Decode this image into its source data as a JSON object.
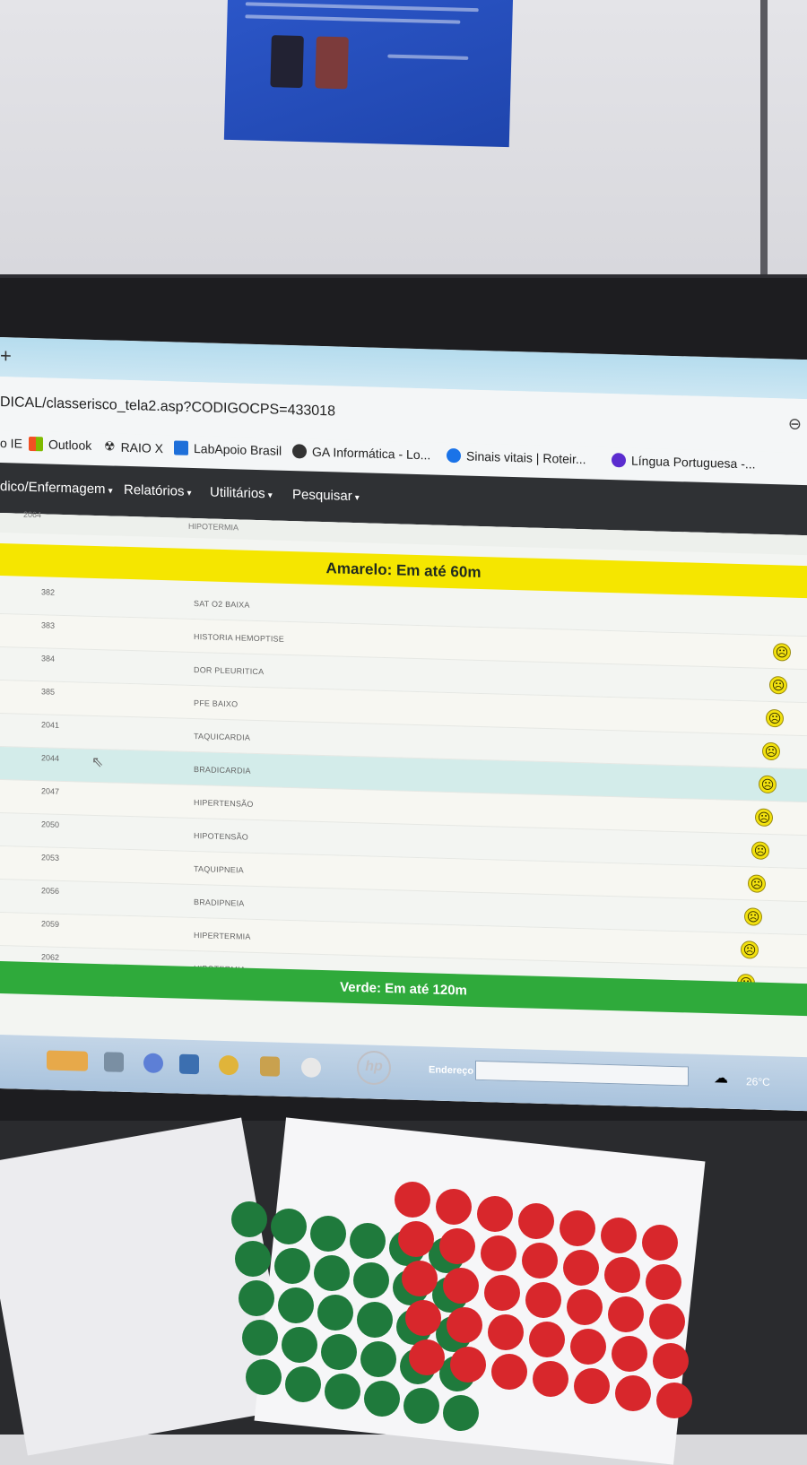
{
  "browser": {
    "url": "DICAL/classerisco_tela2.asp?CODIGOCPS=433018",
    "bookmarks": [
      {
        "label": "o IE",
        "icon": "ie-icon"
      },
      {
        "label": "Outlook",
        "icon": "windows-logo-icon"
      },
      {
        "label": "RAIO X",
        "icon": "radiation-icon"
      },
      {
        "label": "LabApoio Brasil",
        "icon": "lab-icon"
      },
      {
        "label": "GA Informática - Lo...",
        "icon": "globe-icon"
      },
      {
        "label": "Sinais vitais | Roteir...",
        "icon": "headset-icon"
      },
      {
        "label": "Língua Portuguesa -...",
        "icon": "tm-badge-icon"
      }
    ]
  },
  "nav": {
    "items": [
      {
        "label": "dico/Enfermagem"
      },
      {
        "label": "Relatórios"
      },
      {
        "label": "Utilitários"
      },
      {
        "label": "Pesquisar"
      }
    ]
  },
  "content": {
    "cut_row_text": "HIPOTERMIA",
    "cut_row_code": "2064",
    "yellow_banner": "Amarelo: Em até 60m",
    "green_banner": "Verde: Em até 120m",
    "rows": [
      {
        "code": "382",
        "desc": "SAT O2 BAIXA"
      },
      {
        "code": "383",
        "desc": "HISTORIA HEMOPTISE"
      },
      {
        "code": "384",
        "desc": "DOR PLEURITICA"
      },
      {
        "code": "385",
        "desc": "PFE BAIXO"
      },
      {
        "code": "2041",
        "desc": "TAQUICARDIA"
      },
      {
        "code": "2044",
        "desc": "BRADICARDIA"
      },
      {
        "code": "2047",
        "desc": "HIPERTENSÃO"
      },
      {
        "code": "2050",
        "desc": "HIPOTENSÃO"
      },
      {
        "code": "2053",
        "desc": "TAQUIPNEIA"
      },
      {
        "code": "2056",
        "desc": "BRADIPNEIA"
      },
      {
        "code": "2059",
        "desc": "HIPERTERMIA"
      },
      {
        "code": "2062",
        "desc": "HIPOTERMIA"
      }
    ]
  },
  "taskbar": {
    "address_label": "Endereço",
    "weather_temp": "26°C"
  },
  "monitor": {
    "brand": "hp"
  },
  "colors": {
    "yellow_banner": "#f5e600",
    "green_banner": "#2faa3b",
    "nav_bg": "#2f3134",
    "green_sticker": "#1f7a3c",
    "red_sticker": "#d8272c"
  }
}
